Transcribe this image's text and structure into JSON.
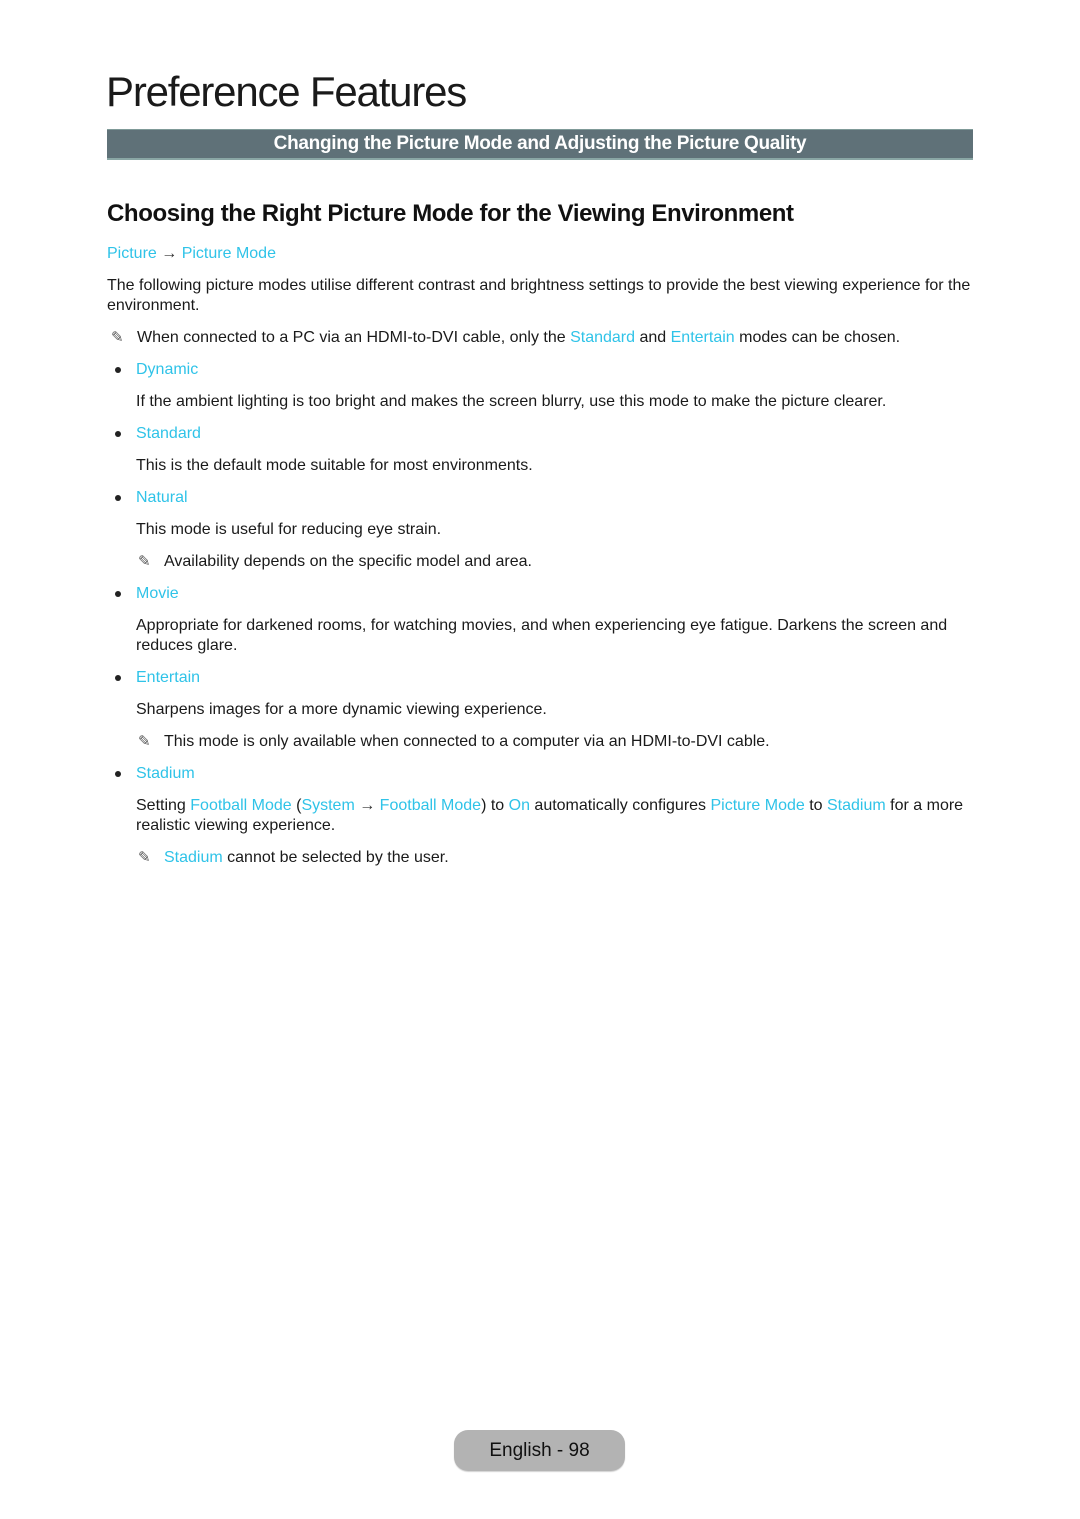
{
  "page_title": "Preference Features",
  "section_bar": "Changing the Picture Mode and Adjusting the Picture Quality",
  "subheading": "Choosing the Right Picture Mode for the Viewing Environment",
  "breadcrumb": {
    "first": "Picture",
    "arrow": "→",
    "second": "Picture Mode"
  },
  "intro": "The following picture modes utilise different contrast and brightness settings to provide the best viewing experience for the environment.",
  "intro_note": {
    "icon": "note-pencil-icon",
    "part1": "When connected to a PC via an HDMI-to-DVI cable, only the ",
    "link1": "Standard",
    "part2": " and ",
    "link2": "Entertain",
    "part3": " modes can be chosen."
  },
  "modes": [
    {
      "name": "Dynamic",
      "desc": "If the ambient lighting is too bright and makes the screen blurry, use this mode to make the picture clearer."
    },
    {
      "name": "Standard",
      "desc": "This is the default mode suitable for most environments."
    },
    {
      "name": "Natural",
      "desc": "This mode is useful for reducing eye strain.",
      "note": "Availability depends on the specific model and area."
    },
    {
      "name": "Movie",
      "desc": "Appropriate for darkened rooms, for watching movies, and when experiencing eye fatigue. Darkens the screen and reduces glare."
    },
    {
      "name": "Entertain",
      "desc": "Sharpens images for a more dynamic viewing experience.",
      "note": "This mode is only available when connected to a computer via an HDMI-to-DVI cable."
    },
    {
      "name": "Stadium"
    }
  ],
  "stadium": {
    "t1": "Setting ",
    "l1": "Football Mode",
    "t2": " (",
    "l2": "System",
    "arrow": " → ",
    "l3": "Football Mode",
    "t3": ") to ",
    "l4": "On",
    "t4": " automatically configures ",
    "l5": "Picture Mode",
    "t5": " to ",
    "l6": "Stadium",
    "t6": " for a more realistic viewing experience.",
    "note_link": "Stadium",
    "note_text": " cannot be selected by the user."
  },
  "footer": "English - 98",
  "colors": {
    "link": "#2fc3e8",
    "section_bar": "#5f7178",
    "footer_badge": "#b3b3b3"
  }
}
